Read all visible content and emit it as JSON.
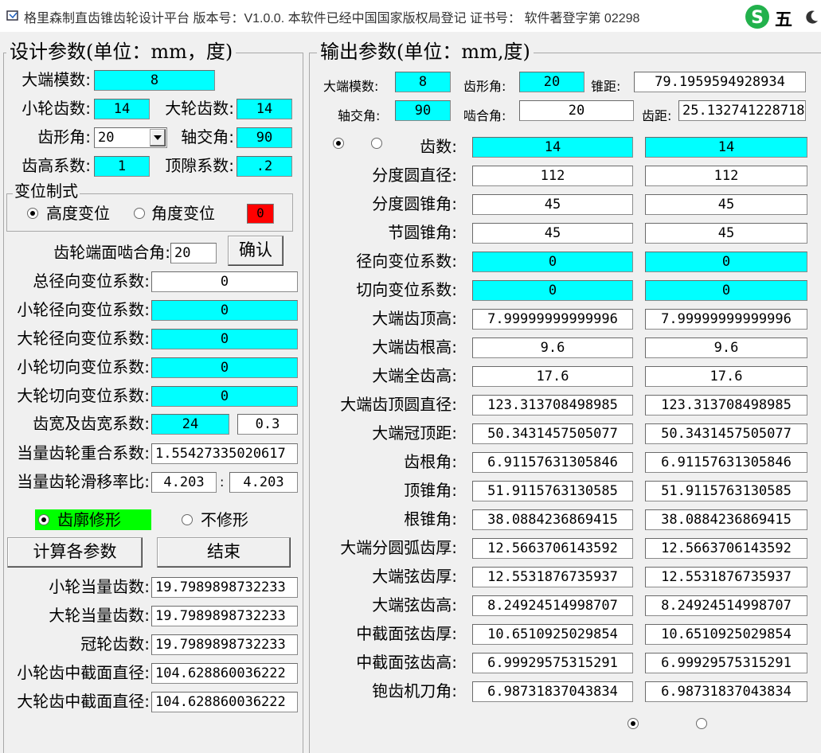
{
  "window": {
    "title": "格里森制直齿锥齿轮设计平台  版本号：V1.0.0.   本软件已经中国国家版权局登记  证书号：  软件著登字第 02298",
    "ime_char": "五"
  },
  "design": {
    "title": "设计参数(单位：mm，度)",
    "module_label": "大端模数:",
    "module": "8",
    "z1_label": "小轮齿数:",
    "z1": "14",
    "z2_label": "大轮齿数:",
    "z2": "14",
    "alpha_label": "齿形角:",
    "alpha": "20",
    "sigma_label": "轴交角:",
    "sigma": "90",
    "ha_label": "齿高系数:",
    "ha": "1",
    "c_label": "顶隙系数:",
    "c": ".2",
    "shift_title": "变位制式",
    "shift_height": "高度变位",
    "shift_angle": "角度变位",
    "indicator": "0",
    "face_angle_label": "齿轮端面啮合角:",
    "face_angle": "20",
    "confirm": "确认",
    "total_radial_label": "总径向变位系数:",
    "total_radial": "0",
    "x1r_label": "小轮径向变位系数:",
    "x1r": "0",
    "x2r_label": "大轮径向变位系数:",
    "x2r": "0",
    "x1t_label": "小轮切向变位系数:",
    "x1t": "0",
    "x2t_label": "大轮切向变位系数:",
    "x2t": "0",
    "width_label": "齿宽及齿宽系数:",
    "width": "24",
    "width_coef": "0.3",
    "overlap_label": "当量齿轮重合系数:",
    "overlap": "1.55427335020617",
    "slip_label": "当量齿轮滑移率比:",
    "slip1": "4.203",
    "slip2": "4.203",
    "profile_mod": "齿廓修形",
    "no_mod": "不修形",
    "calc": "计算各参数",
    "end": "结束",
    "zv1_label": "小轮当量齿数:",
    "zv1": "19.7989898732233",
    "zv2_label": "大轮当量齿数:",
    "zv2": "19.7989898732233",
    "zc_label": "冠轮齿数:",
    "zc": "19.7989898732233",
    "dm1_label": "小轮齿中截面直径:",
    "dm1": "104.628860036222",
    "dm2_label": "大轮齿中截面直径:",
    "dm2": "104.628860036222"
  },
  "output": {
    "title": "输出参数(单位：mm,度)",
    "module_label": "大端模数:",
    "module": "8",
    "alpha_label": "齿形角:",
    "alpha": "20",
    "cone_label": "锥距:",
    "cone": "79.1959594928934",
    "sigma_label": "轴交角:",
    "sigma": "90",
    "mesh_label": "啮合角:",
    "mesh": "20",
    "pitch_label": "齿距:",
    "pitch": "25.132741228718",
    "rows": [
      {
        "label": "齿数:",
        "v1": "14",
        "v2": "14",
        "cyan": true
      },
      {
        "label": "分度圆直径:",
        "v1": "112",
        "v2": "112",
        "cyan": false
      },
      {
        "label": "分度圆锥角:",
        "v1": "45",
        "v2": "45",
        "cyan": false
      },
      {
        "label": "节圆锥角:",
        "v1": "45",
        "v2": "45",
        "cyan": false
      },
      {
        "label": "径向变位系数:",
        "v1": "0",
        "v2": "0",
        "cyan": true
      },
      {
        "label": "切向变位系数:",
        "v1": "0",
        "v2": "0",
        "cyan": true
      },
      {
        "label": "大端齿顶高:",
        "v1": "7.99999999999996",
        "v2": "7.99999999999996",
        "cyan": false
      },
      {
        "label": "大端齿根高:",
        "v1": "9.6",
        "v2": "9.6",
        "cyan": false
      },
      {
        "label": "大端全齿高:",
        "v1": "17.6",
        "v2": "17.6",
        "cyan": false
      },
      {
        "label": "大端齿顶圆直径:",
        "v1": "123.313708498985",
        "v2": "123.313708498985",
        "cyan": false
      },
      {
        "label": "大端冠顶距:",
        "v1": "50.3431457505077",
        "v2": "50.3431457505077",
        "cyan": false
      },
      {
        "label": "齿根角:",
        "v1": "6.91157631305846",
        "v2": "6.91157631305846",
        "cyan": false
      },
      {
        "label": "顶锥角:",
        "v1": "51.9115763130585",
        "v2": "51.9115763130585",
        "cyan": false
      },
      {
        "label": "根锥角:",
        "v1": "38.0884236869415",
        "v2": "38.0884236869415",
        "cyan": false
      },
      {
        "label": "大端分圆弧齿厚:",
        "v1": "12.5663706143592",
        "v2": "12.5663706143592",
        "cyan": false
      },
      {
        "label": "大端弦齿厚:",
        "v1": "12.5531876735937",
        "v2": "12.5531876735937",
        "cyan": false
      },
      {
        "label": "大端弦齿高:",
        "v1": "8.24924514998707",
        "v2": "8.24924514998707",
        "cyan": false
      },
      {
        "label": "中截面弦齿厚:",
        "v1": "10.6510925029854",
        "v2": "10.6510925029854",
        "cyan": false
      },
      {
        "label": "中截面弦齿高:",
        "v1": "6.99929575315291",
        "v2": "6.99929575315291",
        "cyan": false
      },
      {
        "label": "铇齿机刀角:",
        "v1": "6.98731837043834",
        "v2": "6.98731837043834",
        "cyan": false
      }
    ]
  },
  "colors": {
    "cyan": "#00ffff",
    "indicator_red": "#ff0000",
    "highlight_green": "#00ff00",
    "ime_green": "#22b14c"
  }
}
